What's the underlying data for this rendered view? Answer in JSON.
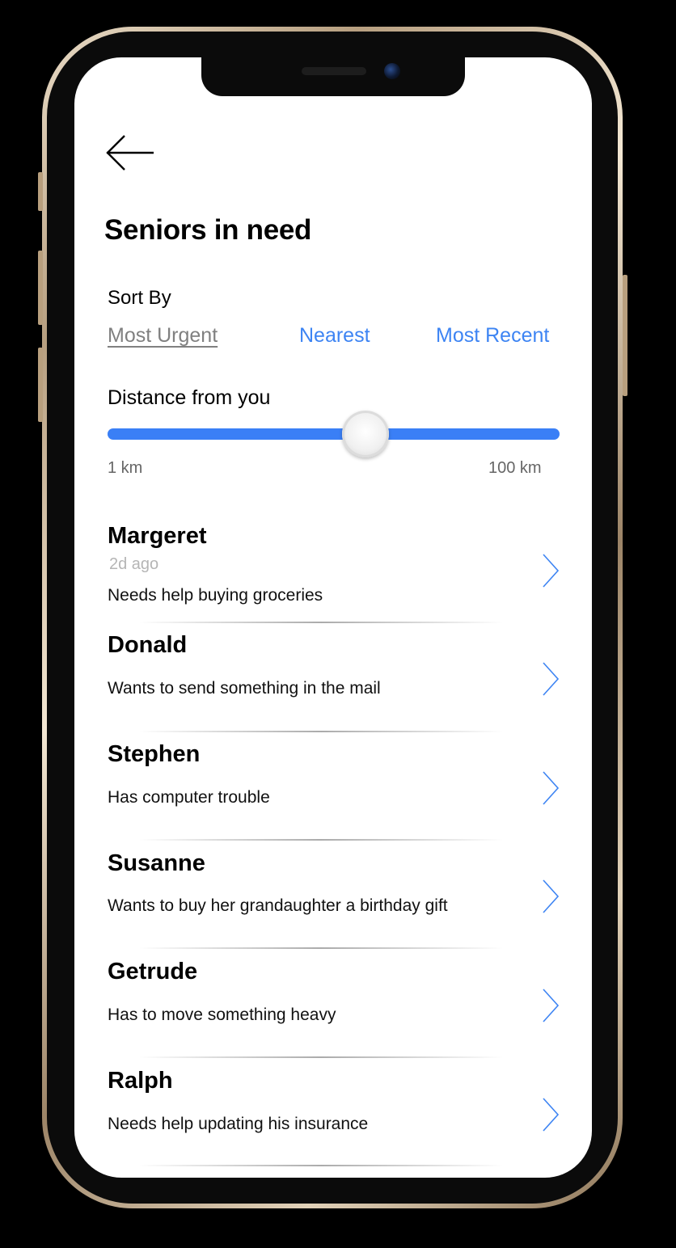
{
  "header": {
    "back_icon": "arrow-left-icon",
    "title": "Seniors in need"
  },
  "sort": {
    "label": "Sort By",
    "options": [
      {
        "label": "Most Urgent",
        "selected": true
      },
      {
        "label": "Nearest",
        "selected": false
      },
      {
        "label": "Most Recent",
        "selected": false
      }
    ]
  },
  "distance": {
    "label": "Distance from you",
    "min_label": "1 km",
    "max_label": "100 km",
    "value_fraction": 0.57
  },
  "people": [
    {
      "name": "Margeret",
      "time": "2d ago",
      "description": "Needs help buying groceries"
    },
    {
      "name": "Donald",
      "time": "",
      "description": "Wants to send something in the mail"
    },
    {
      "name": "Stephen",
      "time": "",
      "description": "Has computer trouble"
    },
    {
      "name": "Susanne",
      "time": "",
      "description": "Wants to buy her grandaughter a birthday gift"
    },
    {
      "name": "Getrude",
      "time": "",
      "description": "Has to move something heavy"
    },
    {
      "name": "Ralph",
      "time": "",
      "description": "Needs help updating his insurance"
    }
  ],
  "colors": {
    "accent": "#3d84f3",
    "slider": "#3a7ff6",
    "muted": "#808080"
  }
}
